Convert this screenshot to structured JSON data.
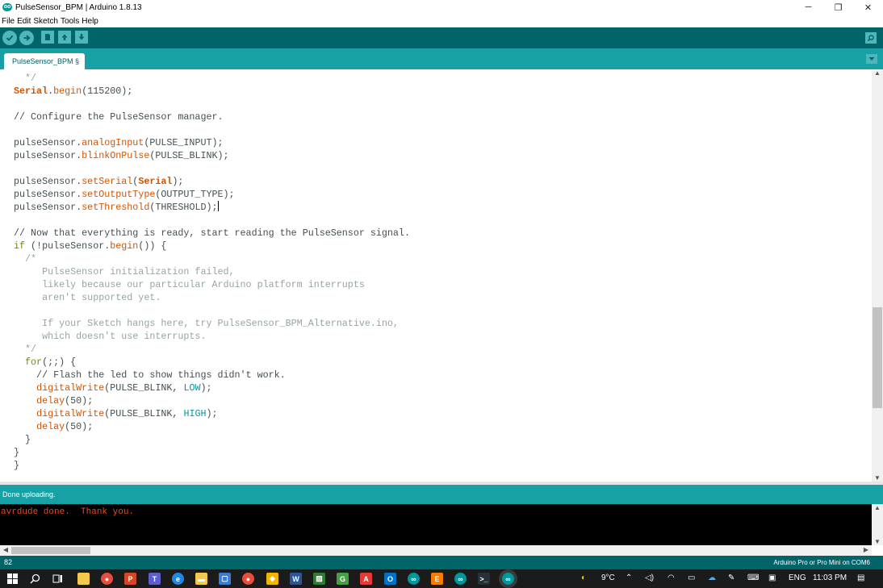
{
  "window": {
    "title": "PulseSensor_BPM | Arduino 1.8.13",
    "logo_glyph": "oo",
    "minimize": "─",
    "restore": "❐",
    "close": "✕"
  },
  "menu": {
    "items": [
      "File",
      "Edit",
      "Sketch",
      "Tools",
      "Help"
    ]
  },
  "tab": {
    "label": "PulseSensor_BPM §"
  },
  "editor": {
    "cursor_line": 11,
    "lines": [
      [
        {
          "t": "  ",
          "c": ""
        },
        {
          "t": "*/",
          "c": "cm"
        }
      ],
      [
        {
          "t": "Serial",
          "c": "kb"
        },
        {
          "t": ".",
          "c": ""
        },
        {
          "t": "begin",
          "c": "fn"
        },
        {
          "t": "(115200);",
          "c": ""
        }
      ],
      [],
      [
        {
          "t": "// Configure the PulseSensor manager.",
          "c": ""
        }
      ],
      [],
      [
        {
          "t": "pulseSensor.",
          "c": ""
        },
        {
          "t": "analogInput",
          "c": "fn"
        },
        {
          "t": "(PULSE_INPUT);",
          "c": ""
        }
      ],
      [
        {
          "t": "pulseSensor.",
          "c": ""
        },
        {
          "t": "blinkOnPulse",
          "c": "fn"
        },
        {
          "t": "(PULSE_BLINK);",
          "c": ""
        }
      ],
      [],
      [
        {
          "t": "pulseSensor.",
          "c": ""
        },
        {
          "t": "setSerial",
          "c": "fn"
        },
        {
          "t": "(",
          "c": ""
        },
        {
          "t": "Serial",
          "c": "kb"
        },
        {
          "t": ");",
          "c": ""
        }
      ],
      [
        {
          "t": "pulseSensor.",
          "c": ""
        },
        {
          "t": "setOutputType",
          "c": "fn"
        },
        {
          "t": "(OUTPUT_TYPE);",
          "c": ""
        }
      ],
      [
        {
          "t": "pulseSensor.",
          "c": ""
        },
        {
          "t": "setThreshold",
          "c": "fn"
        },
        {
          "t": "(THRESHOLD);",
          "c": ""
        }
      ],
      [],
      [
        {
          "t": "// Now that everything is ready, start reading the PulseSensor signal.",
          "c": ""
        }
      ],
      [
        {
          "t": "if",
          "c": "kw"
        },
        {
          "t": " (!pulseSensor.",
          "c": ""
        },
        {
          "t": "begin",
          "c": "fn"
        },
        {
          "t": "()) {",
          "c": ""
        }
      ],
      [
        {
          "t": "  /*",
          "c": "cm"
        }
      ],
      [
        {
          "t": "     PulseSensor initialization failed,",
          "c": "cm"
        }
      ],
      [
        {
          "t": "     likely because our particular Arduino platform interrupts",
          "c": "cm"
        }
      ],
      [
        {
          "t": "     aren't supported yet.",
          "c": "cm"
        }
      ],
      [],
      [
        {
          "t": "     If your Sketch hangs here, try PulseSensor_BPM_Alternative.ino,",
          "c": "cm"
        }
      ],
      [
        {
          "t": "     which doesn't use interrupts.",
          "c": "cm"
        }
      ],
      [
        {
          "t": "  */",
          "c": "cm"
        }
      ],
      [
        {
          "t": "  ",
          "c": ""
        },
        {
          "t": "for",
          "c": "kw"
        },
        {
          "t": "(;;) {",
          "c": ""
        }
      ],
      [
        {
          "t": "    // Flash the led to show things didn't work.",
          "c": ""
        }
      ],
      [
        {
          "t": "    ",
          "c": ""
        },
        {
          "t": "digitalWrite",
          "c": "fn"
        },
        {
          "t": "(PULSE_BLINK, ",
          "c": ""
        },
        {
          "t": "LOW",
          "c": "cs"
        },
        {
          "t": ");",
          "c": ""
        }
      ],
      [
        {
          "t": "    ",
          "c": ""
        },
        {
          "t": "delay",
          "c": "fn"
        },
        {
          "t": "(50);",
          "c": ""
        }
      ],
      [
        {
          "t": "    ",
          "c": ""
        },
        {
          "t": "digitalWrite",
          "c": "fn"
        },
        {
          "t": "(PULSE_BLINK, ",
          "c": ""
        },
        {
          "t": "HIGH",
          "c": "cs"
        },
        {
          "t": ");",
          "c": ""
        }
      ],
      [
        {
          "t": "    ",
          "c": ""
        },
        {
          "t": "delay",
          "c": "fn"
        },
        {
          "t": "(50);",
          "c": ""
        }
      ],
      [
        {
          "t": "  }",
          "c": ""
        }
      ],
      [
        {
          "t": "}",
          "c": ""
        }
      ],
      [
        {
          "t": "}",
          "c": ""
        }
      ]
    ]
  },
  "status": {
    "message": "Done uploading."
  },
  "console": {
    "output": "avrdude done.  Thank you."
  },
  "footer": {
    "line_number": "82",
    "board": "Arduino Pro or Pro Mini on COM6"
  },
  "taskbar": {
    "weather": "9°C",
    "language": "ENG",
    "time": "11:03 PM",
    "apps": [
      "file-explorer",
      "chrome",
      "powerpoint",
      "teams",
      "edge",
      "explorer",
      "store",
      "chrome",
      "git",
      "word",
      "photos",
      "app-green",
      "acrobat",
      "outlook",
      "arduino",
      "e-app",
      "arduino",
      "terminal",
      "arduino-active"
    ]
  },
  "colors": {
    "teal_dark": "#006468",
    "teal": "#17a1a5",
    "button": "#4db7bb",
    "console_text": "#e34c22"
  }
}
